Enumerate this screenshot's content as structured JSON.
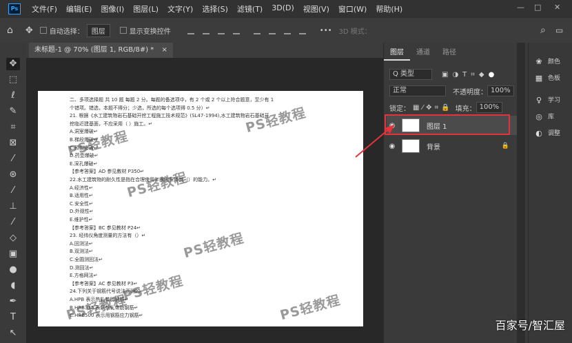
{
  "menubar": {
    "logo": "Ps",
    "items": [
      "文件(F)",
      "编辑(E)",
      "图像(I)",
      "图层(L)",
      "文字(Y)",
      "选择(S)",
      "滤镜(T)",
      "3D(D)",
      "视图(V)",
      "窗口(W)",
      "帮助(H)"
    ],
    "minimize": "—",
    "maximize": "□",
    "close": "✕"
  },
  "options": {
    "home": "⌂",
    "move": "✥",
    "auto_select": "自动选择：",
    "auto_select_value": "图层",
    "show_transform": "显示变换控件",
    "more": "•••",
    "mode3d": "3D 模式：",
    "search": "⌕"
  },
  "tab": {
    "title": "未标题-1 @ 70% (图层 1, RGB/8#) *",
    "close": "×"
  },
  "document": {
    "lines": [
      "二、多项选择题 共 10 题 每题 2 分。每题的备选项中，有 2 个或 2 个以上符合题意，至少有 1",
      "个错项。错选，本题不得分；少选，所选的每个选项得 0.5 分）↵",
      "21. 根据《水工建筑物岩石基础开挖工程施工技术规范》(SL47-1994),水工建筑物岩石基础开",
      "挖临近建基面，不应采用（ ）施工。↵",
      "A.洞室爆破↵",
      "B.梯段爆破↵",
      "C.预裂爆破↵",
      "D.药壶爆破↵",
      "E.深孔爆破↵",
      "【参考答案】AD 参见教材 P350↵",
      "22.水工建筑物的耐久性是指在合理使用年限内保持其（）的能力。↵",
      "A.经济性↵",
      "B.适用性↵",
      "C.安全性↵",
      "D.外观性↵",
      "E.维护性↵",
      "【参考答案】BC 参见教材 P24↵",
      "23. 经纬仪角度测量的方法有（）↵",
      "A.回测法↵",
      "B.双测法↵",
      "C.全圆测回法↵",
      "D.测回法↵",
      "E.方格网法↵",
      "【参考答案】AC 参见教材 P3↵",
      "24.下列关于钢筋代号说法正确的↵",
      "A.HPB 表示热轧带肋钢筋↵",
      "B.HRB335 表示热轧带肋钢筋↵",
      "C.HRB500 表示用钢筋应力钢筋↵"
    ],
    "watermarks": [
      "PS轻教程",
      "PS轻教程",
      "PS轻教程",
      "PS轻教程",
      "PS轻教程",
      "PS轻教程",
      "PS轻教程"
    ]
  },
  "layers_panel": {
    "tabs": [
      "图层",
      "通道",
      "路径"
    ],
    "filter": "Q 类型",
    "blend_mode": "正常",
    "opacity_label": "不透明度：",
    "opacity_value": "100%",
    "lock_label": "锁定：",
    "fill_label": "填充：",
    "fill_value": "100%",
    "layers": [
      {
        "name": "图层 1",
        "selected": true
      },
      {
        "name": "背景",
        "locked": true
      }
    ],
    "lock_icon": "🔒"
  },
  "right_panel": {
    "items": [
      "颜色",
      "色板",
      "学习",
      "库",
      "调整"
    ]
  },
  "caption": "百家号/智汇屋",
  "colors": {
    "highlight": "#e6333b",
    "ps_blue": "#31a8ff"
  }
}
